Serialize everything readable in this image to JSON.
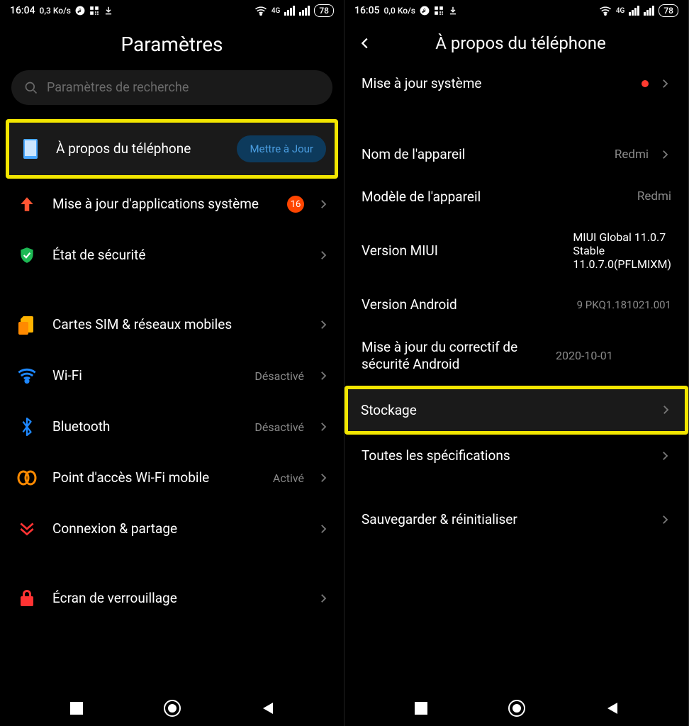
{
  "left": {
    "status": {
      "time": "16:04",
      "speed": "0,3 Ko/s",
      "net": "4G",
      "battery": "78"
    },
    "title": "Paramètres",
    "search_placeholder": "Paramètres de recherche",
    "items": {
      "about": {
        "label": "À propos du téléphone",
        "button": "Mettre à Jour"
      },
      "sysapps": {
        "label": "Mise à jour d'applications système",
        "badge": "16"
      },
      "security": {
        "label": "État de sécurité"
      },
      "sim": {
        "label": "Cartes SIM & réseaux mobiles"
      },
      "wifi": {
        "label": "Wi-Fi",
        "value": "Désactivé"
      },
      "bt": {
        "label": "Bluetooth",
        "value": "Désactivé"
      },
      "hotspot": {
        "label": "Point d'accès Wi-Fi mobile",
        "value": "Activé"
      },
      "share": {
        "label": "Connexion & partage"
      },
      "lock": {
        "label": "Écran de verrouillage"
      }
    }
  },
  "right": {
    "status": {
      "time": "16:05",
      "speed": "0,0 Ko/s",
      "net": "4G",
      "battery": "78"
    },
    "title": "À propos du téléphone",
    "items": {
      "update": {
        "label": "Mise à jour système"
      },
      "name": {
        "label": "Nom de l'appareil",
        "value": "Redmi"
      },
      "model": {
        "label": "Modèle de l'appareil",
        "value": "Redmi"
      },
      "miui": {
        "label": "Version MIUI",
        "value_l1": "MIUI Global 11.0.7",
        "value_l2": "Stable",
        "value_l3": "11.0.7.0(PFLMIXM)"
      },
      "android": {
        "label": "Version Android",
        "value": "9 PKQ1.181021.001"
      },
      "patch": {
        "label": "Mise à jour du correctif de sécurité Android",
        "value": "2020-10-01"
      },
      "storage": {
        "label": "Stockage"
      },
      "specs": {
        "label": "Toutes les spécifications"
      },
      "backup": {
        "label": "Sauvegarder & réinitialiser"
      }
    }
  }
}
